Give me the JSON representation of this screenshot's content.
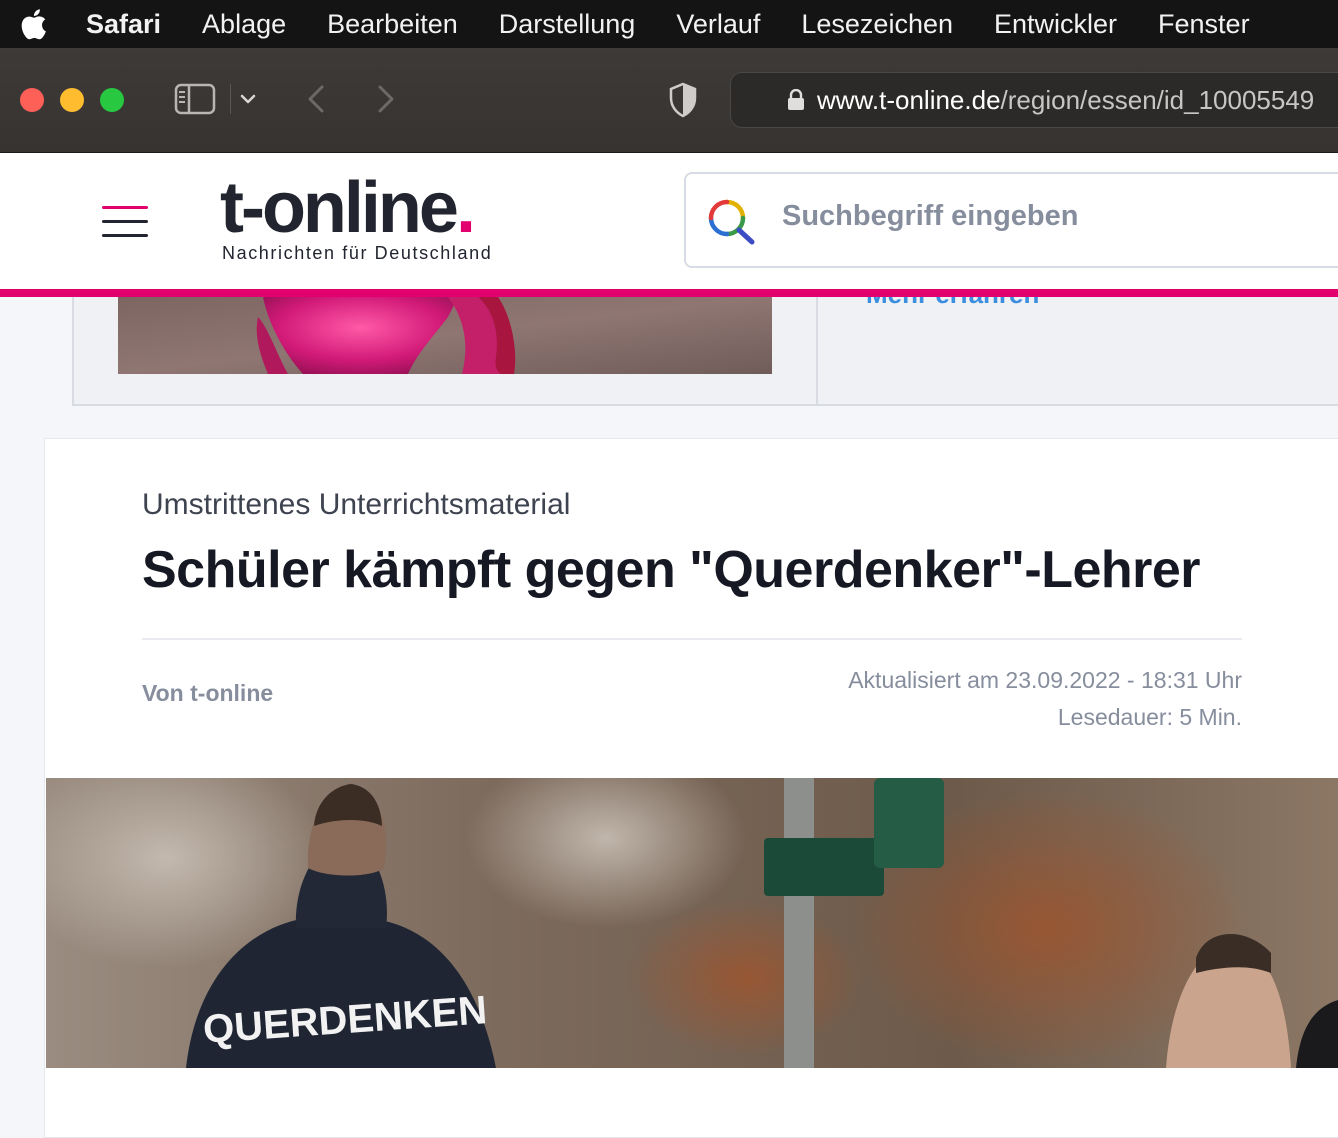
{
  "menubar": {
    "app": "Safari",
    "items": [
      "Ablage",
      "Bearbeiten",
      "Darstellung",
      "Verlauf",
      "Lesezeichen",
      "Entwickler",
      "Fenster"
    ]
  },
  "browser": {
    "url_host": "www.t-online.de",
    "url_path": "/region/essen/id_10005549"
  },
  "site": {
    "logo_main": "t-online",
    "logo_dot": ".",
    "tagline": "Nachrichten für Deutschland",
    "search_placeholder": "Suchbegriff eingeben",
    "accent_color": "#e2006f"
  },
  "teaser": {
    "link_text": "Mehr erfahren"
  },
  "article": {
    "kicker": "Umstrittenes Unterrichtsmaterial",
    "headline": "Schüler kämpft gegen \"Querdenker\"-Lehrer",
    "author": "Von t-online",
    "updated": "Aktualisiert am 23.09.2022 - 18:31 Uhr",
    "reading_time": "Lesedauer: 5 Min.",
    "hero_hoodie_text": "QUERDENKEN"
  }
}
